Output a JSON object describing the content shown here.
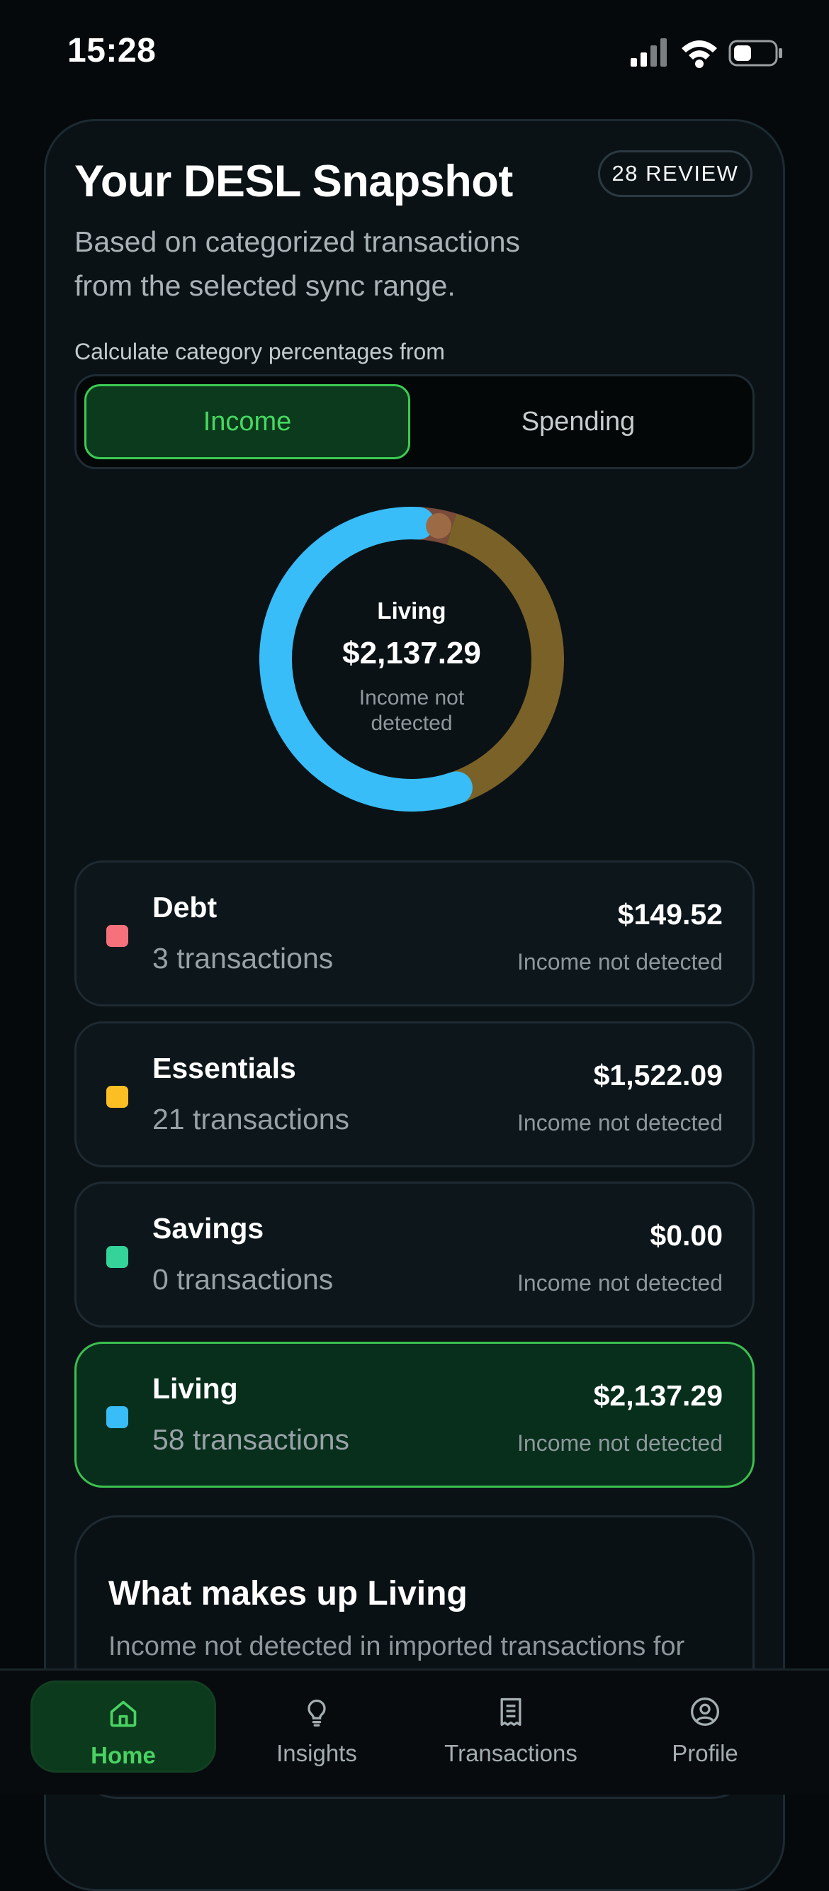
{
  "status": {
    "time": "15:28"
  },
  "header": {
    "title": "Your DESL Snapshot",
    "review_badge": "28 REVIEW",
    "subtitle": "Based on categorized transactions from the selected sync range."
  },
  "calc": {
    "label": "Calculate category percentages from",
    "options": [
      "Income",
      "Spending"
    ],
    "selected": "Income"
  },
  "donut": {
    "center_label": "Living",
    "center_amount": "$2,137.29",
    "center_note": "Income not detected",
    "segments": [
      {
        "name": "Living",
        "value": 2137.29,
        "color": "#38bdf8"
      },
      {
        "name": "Essentials",
        "value": 1522.09,
        "color": "#7a6128"
      },
      {
        "name": "Debt",
        "value": 149.52,
        "color": "#7a4a3a"
      }
    ]
  },
  "categories": [
    {
      "name": "Debt",
      "count": "3 transactions",
      "amount": "$149.52",
      "note": "Income not detected",
      "color": "#f7717d",
      "active": false
    },
    {
      "name": "Essentials",
      "count": "21 transactions",
      "amount": "$1,522.09",
      "note": "Income not detected",
      "color": "#fbbf24",
      "active": false
    },
    {
      "name": "Savings",
      "count": "0 transactions",
      "amount": "$0.00",
      "note": "Income not detected",
      "color": "#34d399",
      "active": false
    },
    {
      "name": "Living",
      "count": "58 transactions",
      "amount": "$2,137.29",
      "note": "Income not detected",
      "color": "#38bdf8",
      "active": true
    }
  ],
  "breakdown": {
    "title": "What makes up Living",
    "text": "Income not detected in imported transactions for this range."
  },
  "tabs": [
    {
      "label": "Home",
      "icon": "home-icon",
      "active": true
    },
    {
      "label": "Insights",
      "icon": "lightbulb-icon",
      "active": false
    },
    {
      "label": "Transactions",
      "icon": "receipt-icon",
      "active": false
    },
    {
      "label": "Profile",
      "icon": "profile-icon",
      "active": false
    }
  ],
  "colors": {
    "accent": "#47d861",
    "background": "#05090c",
    "card": "#0b1216"
  }
}
